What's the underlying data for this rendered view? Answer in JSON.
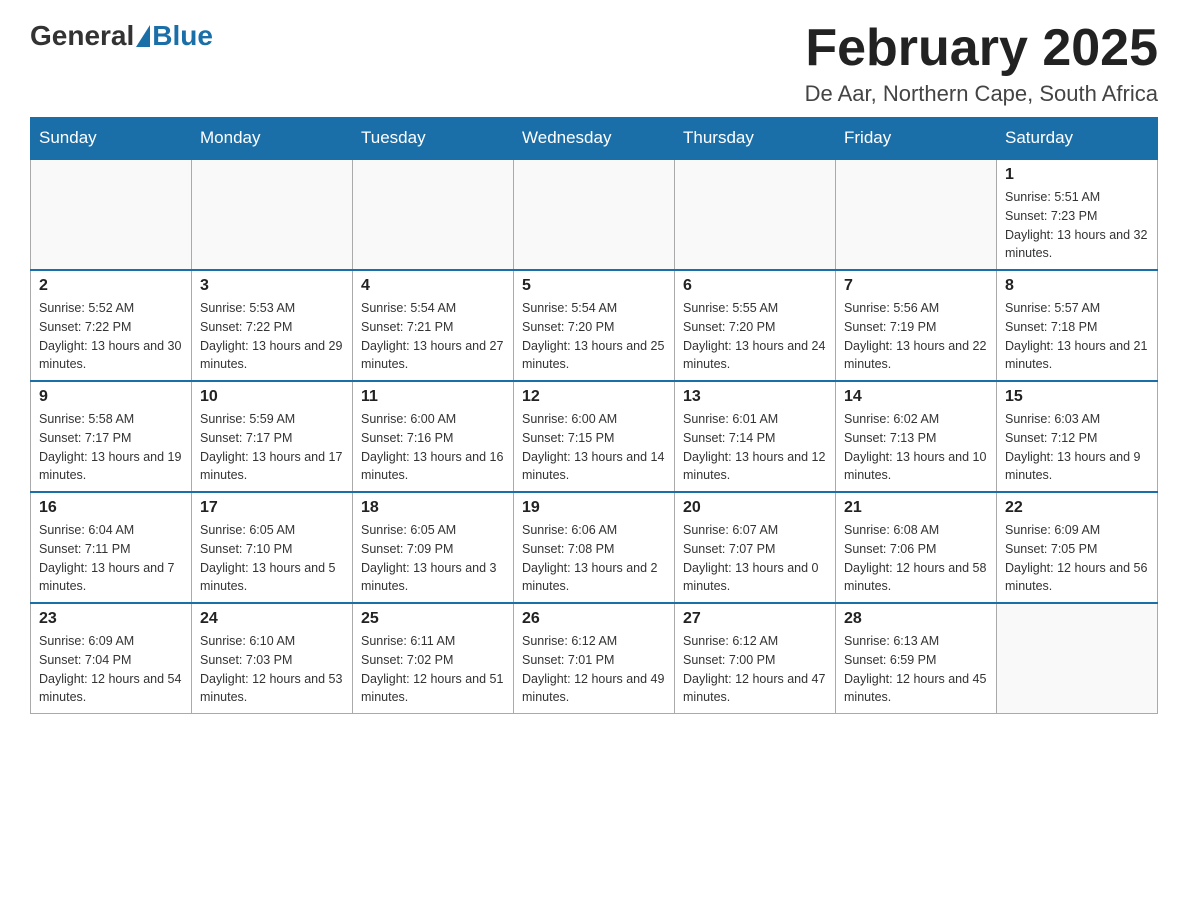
{
  "header": {
    "logo_general": "General",
    "logo_blue": "Blue",
    "month_title": "February 2025",
    "location": "De Aar, Northern Cape, South Africa"
  },
  "weekdays": [
    "Sunday",
    "Monday",
    "Tuesday",
    "Wednesday",
    "Thursday",
    "Friday",
    "Saturday"
  ],
  "weeks": [
    [
      {
        "day": "",
        "sunrise": "",
        "sunset": "",
        "daylight": ""
      },
      {
        "day": "",
        "sunrise": "",
        "sunset": "",
        "daylight": ""
      },
      {
        "day": "",
        "sunrise": "",
        "sunset": "",
        "daylight": ""
      },
      {
        "day": "",
        "sunrise": "",
        "sunset": "",
        "daylight": ""
      },
      {
        "day": "",
        "sunrise": "",
        "sunset": "",
        "daylight": ""
      },
      {
        "day": "",
        "sunrise": "",
        "sunset": "",
        "daylight": ""
      },
      {
        "day": "1",
        "sunrise": "Sunrise: 5:51 AM",
        "sunset": "Sunset: 7:23 PM",
        "daylight": "Daylight: 13 hours and 32 minutes."
      }
    ],
    [
      {
        "day": "2",
        "sunrise": "Sunrise: 5:52 AM",
        "sunset": "Sunset: 7:22 PM",
        "daylight": "Daylight: 13 hours and 30 minutes."
      },
      {
        "day": "3",
        "sunrise": "Sunrise: 5:53 AM",
        "sunset": "Sunset: 7:22 PM",
        "daylight": "Daylight: 13 hours and 29 minutes."
      },
      {
        "day": "4",
        "sunrise": "Sunrise: 5:54 AM",
        "sunset": "Sunset: 7:21 PM",
        "daylight": "Daylight: 13 hours and 27 minutes."
      },
      {
        "day": "5",
        "sunrise": "Sunrise: 5:54 AM",
        "sunset": "Sunset: 7:20 PM",
        "daylight": "Daylight: 13 hours and 25 minutes."
      },
      {
        "day": "6",
        "sunrise": "Sunrise: 5:55 AM",
        "sunset": "Sunset: 7:20 PM",
        "daylight": "Daylight: 13 hours and 24 minutes."
      },
      {
        "day": "7",
        "sunrise": "Sunrise: 5:56 AM",
        "sunset": "Sunset: 7:19 PM",
        "daylight": "Daylight: 13 hours and 22 minutes."
      },
      {
        "day": "8",
        "sunrise": "Sunrise: 5:57 AM",
        "sunset": "Sunset: 7:18 PM",
        "daylight": "Daylight: 13 hours and 21 minutes."
      }
    ],
    [
      {
        "day": "9",
        "sunrise": "Sunrise: 5:58 AM",
        "sunset": "Sunset: 7:17 PM",
        "daylight": "Daylight: 13 hours and 19 minutes."
      },
      {
        "day": "10",
        "sunrise": "Sunrise: 5:59 AM",
        "sunset": "Sunset: 7:17 PM",
        "daylight": "Daylight: 13 hours and 17 minutes."
      },
      {
        "day": "11",
        "sunrise": "Sunrise: 6:00 AM",
        "sunset": "Sunset: 7:16 PM",
        "daylight": "Daylight: 13 hours and 16 minutes."
      },
      {
        "day": "12",
        "sunrise": "Sunrise: 6:00 AM",
        "sunset": "Sunset: 7:15 PM",
        "daylight": "Daylight: 13 hours and 14 minutes."
      },
      {
        "day": "13",
        "sunrise": "Sunrise: 6:01 AM",
        "sunset": "Sunset: 7:14 PM",
        "daylight": "Daylight: 13 hours and 12 minutes."
      },
      {
        "day": "14",
        "sunrise": "Sunrise: 6:02 AM",
        "sunset": "Sunset: 7:13 PM",
        "daylight": "Daylight: 13 hours and 10 minutes."
      },
      {
        "day": "15",
        "sunrise": "Sunrise: 6:03 AM",
        "sunset": "Sunset: 7:12 PM",
        "daylight": "Daylight: 13 hours and 9 minutes."
      }
    ],
    [
      {
        "day": "16",
        "sunrise": "Sunrise: 6:04 AM",
        "sunset": "Sunset: 7:11 PM",
        "daylight": "Daylight: 13 hours and 7 minutes."
      },
      {
        "day": "17",
        "sunrise": "Sunrise: 6:05 AM",
        "sunset": "Sunset: 7:10 PM",
        "daylight": "Daylight: 13 hours and 5 minutes."
      },
      {
        "day": "18",
        "sunrise": "Sunrise: 6:05 AM",
        "sunset": "Sunset: 7:09 PM",
        "daylight": "Daylight: 13 hours and 3 minutes."
      },
      {
        "day": "19",
        "sunrise": "Sunrise: 6:06 AM",
        "sunset": "Sunset: 7:08 PM",
        "daylight": "Daylight: 13 hours and 2 minutes."
      },
      {
        "day": "20",
        "sunrise": "Sunrise: 6:07 AM",
        "sunset": "Sunset: 7:07 PM",
        "daylight": "Daylight: 13 hours and 0 minutes."
      },
      {
        "day": "21",
        "sunrise": "Sunrise: 6:08 AM",
        "sunset": "Sunset: 7:06 PM",
        "daylight": "Daylight: 12 hours and 58 minutes."
      },
      {
        "day": "22",
        "sunrise": "Sunrise: 6:09 AM",
        "sunset": "Sunset: 7:05 PM",
        "daylight": "Daylight: 12 hours and 56 minutes."
      }
    ],
    [
      {
        "day": "23",
        "sunrise": "Sunrise: 6:09 AM",
        "sunset": "Sunset: 7:04 PM",
        "daylight": "Daylight: 12 hours and 54 minutes."
      },
      {
        "day": "24",
        "sunrise": "Sunrise: 6:10 AM",
        "sunset": "Sunset: 7:03 PM",
        "daylight": "Daylight: 12 hours and 53 minutes."
      },
      {
        "day": "25",
        "sunrise": "Sunrise: 6:11 AM",
        "sunset": "Sunset: 7:02 PM",
        "daylight": "Daylight: 12 hours and 51 minutes."
      },
      {
        "day": "26",
        "sunrise": "Sunrise: 6:12 AM",
        "sunset": "Sunset: 7:01 PM",
        "daylight": "Daylight: 12 hours and 49 minutes."
      },
      {
        "day": "27",
        "sunrise": "Sunrise: 6:12 AM",
        "sunset": "Sunset: 7:00 PM",
        "daylight": "Daylight: 12 hours and 47 minutes."
      },
      {
        "day": "28",
        "sunrise": "Sunrise: 6:13 AM",
        "sunset": "Sunset: 6:59 PM",
        "daylight": "Daylight: 12 hours and 45 minutes."
      },
      {
        "day": "",
        "sunrise": "",
        "sunset": "",
        "daylight": ""
      }
    ]
  ]
}
